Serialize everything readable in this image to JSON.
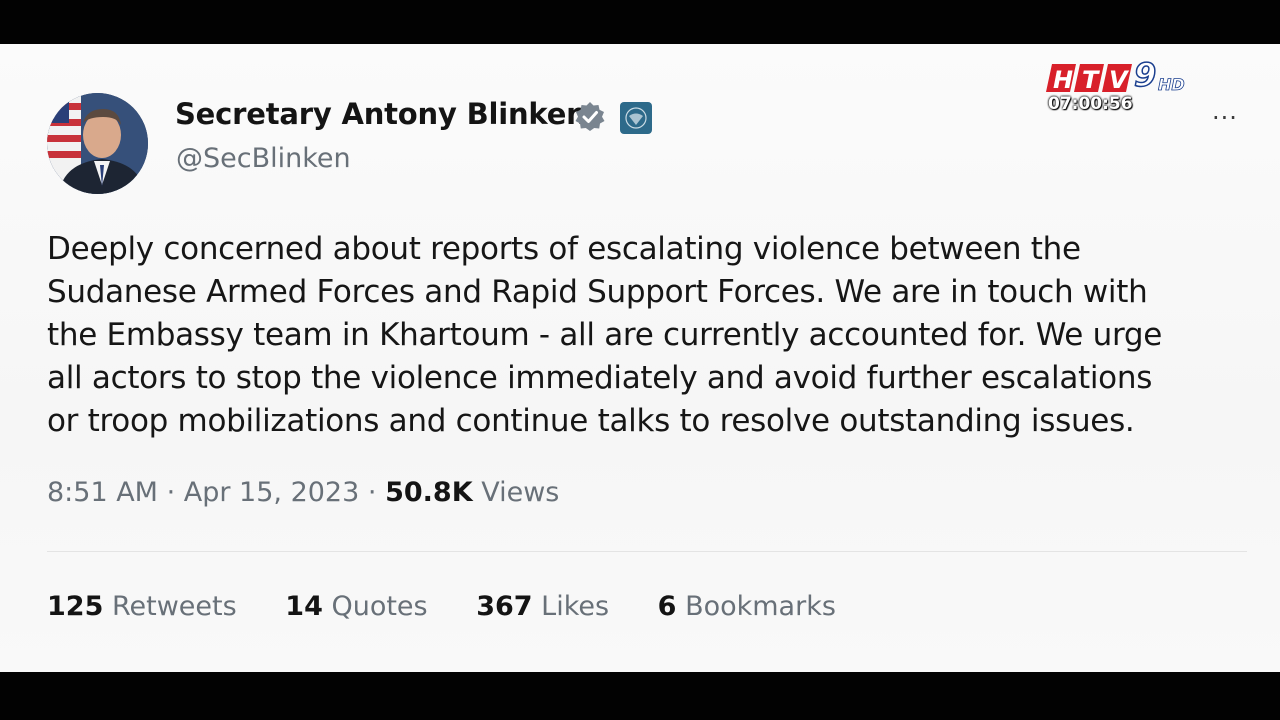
{
  "tweet": {
    "author": {
      "display_name": "Secretary Antony Blinken",
      "handle": "@SecBlinken"
    },
    "text_lines": [
      "Deeply concerned about reports of escalating violence between the",
      "Sudanese Armed Forces and Rapid Support Forces. We are in touch with",
      "the Embassy team in Khartoum - all are currently accounted for. We urge",
      "all actors to stop the violence immediately and avoid further escalations",
      "or troop mobilizations and continue talks to resolve outstanding issues."
    ],
    "meta": {
      "time": "8:51 AM",
      "separator": "·",
      "date": "Apr 15, 2023",
      "views_count": "50.8K",
      "views_label": "Views"
    },
    "stats": {
      "retweets_count": "125",
      "retweets_label": "Retweets",
      "quotes_count": "14",
      "quotes_label": "Quotes",
      "likes_count": "367",
      "likes_label": "Likes",
      "bookmarks_count": "6",
      "bookmarks_label": "Bookmarks"
    },
    "more_label": "···"
  },
  "broadcast": {
    "logo_text": "HTV9HD",
    "clock": "07:00:56"
  },
  "icons": {
    "verified": "verified-check-icon",
    "government": "government-seal-icon",
    "more": "more-options-icon"
  },
  "colors": {
    "name_text": "#141414",
    "secondary_text": "#687078",
    "verified_badge": "#7a8590",
    "logo_red": "#d8202a",
    "logo_blue": "#1b3f8f"
  }
}
